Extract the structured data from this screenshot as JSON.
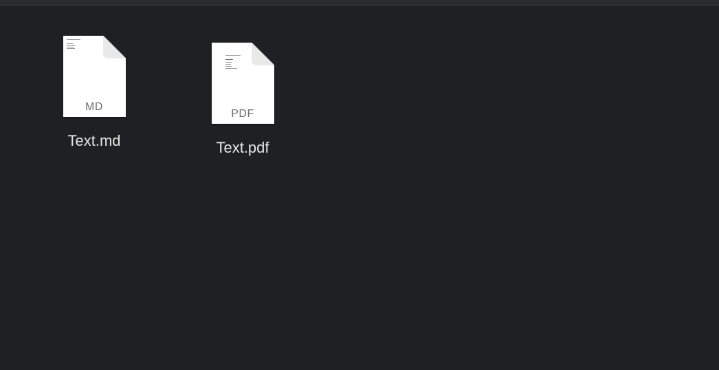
{
  "desktop": {
    "files": [
      {
        "name": "Text.md",
        "type_label": "MD",
        "icon": "markdown-document-icon"
      },
      {
        "name": "Text.pdf",
        "type_label": "PDF",
        "icon": "pdf-document-icon"
      }
    ]
  },
  "colors": {
    "background": "#1f2023",
    "top_bar": "#2b2c2f",
    "label_text": "#e6e6e6",
    "icon_page": "#ffffff",
    "type_text": "#6e6e6e"
  }
}
